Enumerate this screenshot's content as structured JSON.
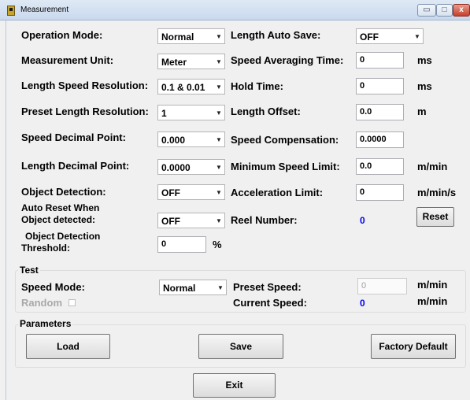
{
  "window": {
    "title": "Measurement",
    "min_glyph": "▭",
    "max_glyph": "□",
    "close_glyph": "x"
  },
  "left": {
    "operation_mode": {
      "label": "Operation Mode:",
      "value": "Normal"
    },
    "measurement_unit": {
      "label": "Measurement Unit:",
      "value": "Meter"
    },
    "length_speed_resolution": {
      "label": "Length Speed Resolution:",
      "value": "0.1 & 0.01"
    },
    "preset_length_resolution": {
      "label": "Preset Length Resolution:",
      "value": "1"
    },
    "speed_decimal_point": {
      "label": "Speed Decimal Point:",
      "value": "0.000"
    },
    "length_decimal_point": {
      "label": "Length Decimal Point:",
      "value": "0.0000"
    },
    "object_detection": {
      "label": "Object Detection:",
      "value": "OFF"
    },
    "auto_reset": {
      "label_line1": "Auto Reset When",
      "label_line2": "Object detected:",
      "value": "OFF"
    },
    "threshold": {
      "label_line1": "Object Detection",
      "label_line2": "Threshold:",
      "value": "0",
      "unit": "%"
    }
  },
  "right": {
    "length_auto_save": {
      "label": "Length Auto Save:",
      "value": "OFF"
    },
    "speed_averaging_time": {
      "label": "Speed Averaging Time:",
      "value": "0",
      "unit": "ms"
    },
    "hold_time": {
      "label": "Hold Time:",
      "value": "0",
      "unit": "ms"
    },
    "length_offset": {
      "label": "Length Offset:",
      "value": "0.0",
      "unit": "m"
    },
    "speed_compensation": {
      "label": "Speed Compensation:",
      "value": "0.0000"
    },
    "minimum_speed_limit": {
      "label": "Minimum Speed Limit:",
      "value": "0.0",
      "unit": "m/min"
    },
    "acceleration_limit": {
      "label": "Acceleration Limit:",
      "value": "0",
      "unit": "m/min/s"
    },
    "reel_number": {
      "label": "Reel Number:",
      "value": "0"
    },
    "reset_button": "Reset"
  },
  "test": {
    "group_label": "Test",
    "speed_mode": {
      "label": "Speed Mode:",
      "value": "Normal"
    },
    "random_label": "Random",
    "preset_speed": {
      "label": "Preset Speed:",
      "value": "0",
      "unit": "m/min"
    },
    "current_speed": {
      "label": "Current Speed:",
      "value": "0",
      "unit": "m/min"
    }
  },
  "parameters": {
    "group_label": "Parameters",
    "load": "Load",
    "save": "Save",
    "factory_default": "Factory Default"
  },
  "exit_button": "Exit",
  "icons": {
    "dropdown_arrow": "▼"
  }
}
